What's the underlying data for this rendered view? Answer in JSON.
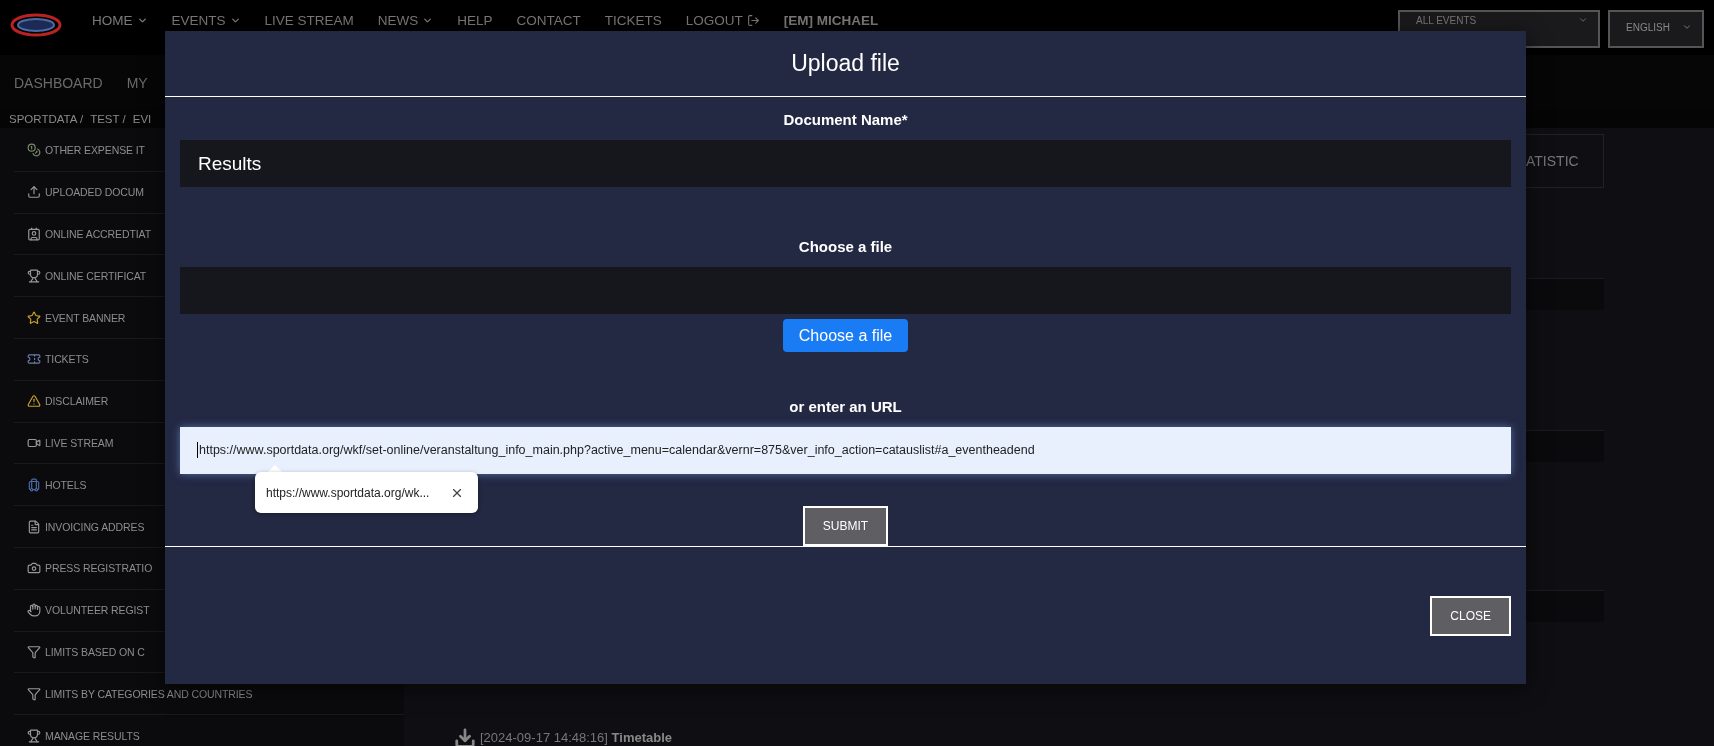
{
  "top_nav": {
    "items": [
      {
        "label": "HOME",
        "kind": "menu"
      },
      {
        "label": "EVENTS",
        "kind": "menu"
      },
      {
        "label": "LIVE STREAM",
        "kind": "link"
      },
      {
        "label": "NEWS",
        "kind": "menu"
      },
      {
        "label": "HELP",
        "kind": "link"
      },
      {
        "label": "CONTACT",
        "kind": "link"
      },
      {
        "label": "TICKETS",
        "kind": "link"
      },
      {
        "label": "LOGOUT",
        "kind": "logout"
      },
      {
        "label": "[EM] MICHAEL",
        "kind": "user"
      }
    ],
    "event_select": {
      "value": "ALL EVENTS"
    },
    "language_select": {
      "value": "ENGLISH"
    }
  },
  "sub_nav": {
    "items": [
      "DASHBOARD",
      "MY"
    ]
  },
  "breadcrumb": [
    "SPORTDATA /",
    "TEST /",
    "EVI"
  ],
  "sidebar": {
    "items": [
      "OTHER EXPENSE IT",
      "UPLOADED DOCUM",
      "ONLINE ACCREDTIAT",
      "ONLINE CERTIFICAT",
      "EVENT BANNER",
      "TICKETS",
      "DISCLAIMER",
      "LIVE STREAM",
      "HOTELS",
      "INVOICING ADDRES",
      "PRESS REGISTRATIO",
      "VOLUNTEER REGIST",
      "LIMITS BASED ON C",
      "LIMITS BY CATEGORIES AND COUNTRIES",
      "MANAGE RESULTS"
    ]
  },
  "content": {
    "tab_label": "ATISTIC",
    "documents": [
      {
        "timestamp": "[2024-09-17 14:48:16]",
        "name": "Timetable"
      }
    ]
  },
  "modal": {
    "title": "Upload file",
    "name_label": "Document Name*",
    "name_value": "Results",
    "file_label": "Choose a file",
    "file_button": "Choose a file",
    "url_label": "or enter an URL",
    "url_value": "https://www.sportdata.org/wkf/set-online/veranstaltung_info_main.php?active_menu=calendar&vernr=875&ver_info_action=catauslist#a_eventheadend",
    "tooltip": "https://www.sportdata.org/wk...",
    "submit": "SUBMIT",
    "close": "CLOSE"
  }
}
